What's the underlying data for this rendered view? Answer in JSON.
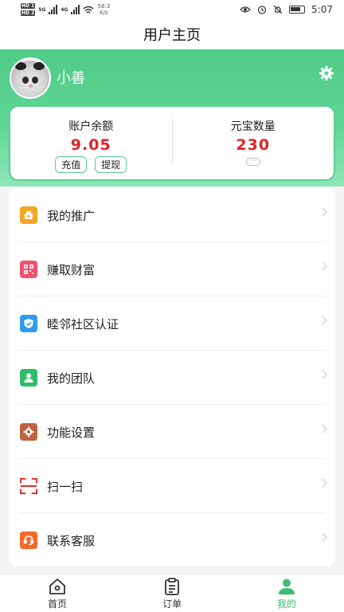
{
  "status_bar": {
    "hd1": "HD 1",
    "hd2": "HD 2",
    "net1": "5G",
    "net2": "4G",
    "speed_value": "58.3",
    "speed_unit": "K/s",
    "time": "5:07"
  },
  "header": {
    "title": "用户主页"
  },
  "profile": {
    "username": "小善"
  },
  "balance": {
    "account_label": "账户余额",
    "account_value": "9.05",
    "recharge_label": "充值",
    "withdraw_label": "提现",
    "yuanbao_label": "元宝数量",
    "yuanbao_value": "230",
    "more_label": "···"
  },
  "menu": {
    "items": [
      {
        "label": "我的推广",
        "icon": "money-bag-icon",
        "color": "#f5a623"
      },
      {
        "label": "赚取财富",
        "icon": "qr-code-icon",
        "color": "#f0506e"
      },
      {
        "label": "睦邻社区认证",
        "icon": "shield-check-icon",
        "color": "#2f9bf0"
      },
      {
        "label": "我的团队",
        "icon": "person-icon",
        "color": "#2ebd6b"
      },
      {
        "label": "功能设置",
        "icon": "settings-icon",
        "color": "#c0623f"
      },
      {
        "label": "扫一扫",
        "icon": "scan-icon",
        "color": "#d8322c"
      },
      {
        "label": "联系客服",
        "icon": "customer-service-icon",
        "color": "#f26a2a"
      }
    ]
  },
  "bottom_nav": {
    "home_label": "首页",
    "orders_label": "订单",
    "mine_label": "我的",
    "accent": "#3dbb74"
  },
  "colors": {
    "brand_green": "#58cf8e",
    "amount_red": "#e02424"
  }
}
